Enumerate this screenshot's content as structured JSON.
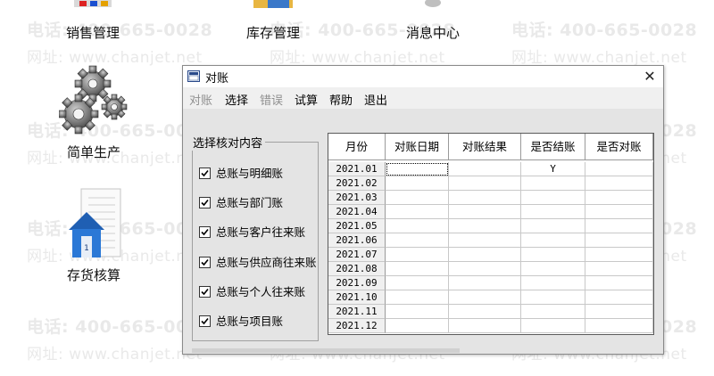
{
  "watermarks": {
    "phone": "电话: 400-665-0028",
    "url": "网址: www.chanjet.net"
  },
  "desktop": {
    "icons": [
      {
        "label": "销售管理",
        "icon": "sales-icon"
      },
      {
        "label": "库存管理",
        "icon": "inventory-icon"
      },
      {
        "label": "消息中心",
        "icon": "message-icon"
      },
      {
        "label": "简单生产",
        "icon": "gears-icon"
      },
      {
        "label": "存货核算",
        "icon": "house-document-icon"
      }
    ]
  },
  "dialog": {
    "title": "对账",
    "close": "✕",
    "menu": [
      {
        "label": "对账",
        "enabled": false
      },
      {
        "label": "选择",
        "enabled": true
      },
      {
        "label": "错误",
        "enabled": false
      },
      {
        "label": "试算",
        "enabled": true
      },
      {
        "label": "帮助",
        "enabled": true
      },
      {
        "label": "退出",
        "enabled": true
      }
    ],
    "group_title": "选择核对内容",
    "checks": [
      {
        "label": "总账与明细账",
        "checked": true
      },
      {
        "label": "总账与部门账",
        "checked": true
      },
      {
        "label": "总账与客户往来账",
        "checked": true
      },
      {
        "label": "总账与供应商往来账",
        "checked": true
      },
      {
        "label": "总账与个人往来账",
        "checked": true
      },
      {
        "label": "总账与项目账",
        "checked": true
      }
    ],
    "grid": {
      "columns": [
        "月份",
        "对账日期",
        "对账结果",
        "是否结账",
        "是否对账"
      ],
      "rows": [
        [
          "2021.01",
          "",
          "",
          "Y",
          ""
        ],
        [
          "2021.02",
          "",
          "",
          "",
          ""
        ],
        [
          "2021.03",
          "",
          "",
          "",
          ""
        ],
        [
          "2021.04",
          "",
          "",
          "",
          ""
        ],
        [
          "2021.05",
          "",
          "",
          "",
          ""
        ],
        [
          "2021.06",
          "",
          "",
          "",
          ""
        ],
        [
          "2021.07",
          "",
          "",
          "",
          ""
        ],
        [
          "2021.08",
          "",
          "",
          "",
          ""
        ],
        [
          "2021.09",
          "",
          "",
          "",
          ""
        ],
        [
          "2021.10",
          "",
          "",
          "",
          ""
        ],
        [
          "2021.11",
          "",
          "",
          "",
          ""
        ],
        [
          "2021.12",
          "",
          "",
          "",
          ""
        ]
      ]
    }
  }
}
